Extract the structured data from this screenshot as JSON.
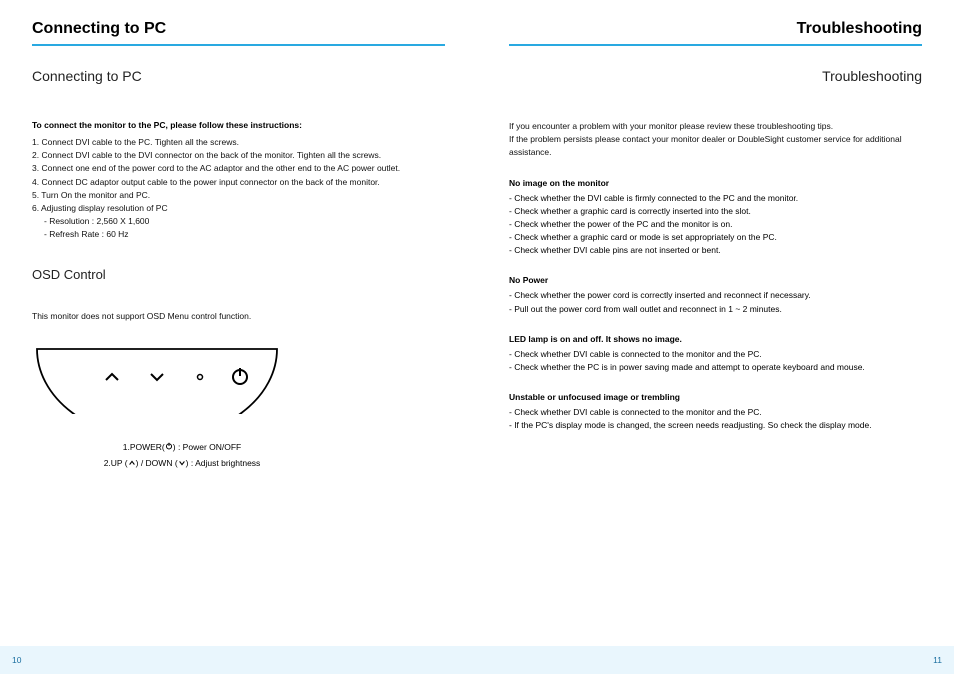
{
  "left": {
    "pageTitle": "Connecting to PC",
    "subhead": "Connecting to PC",
    "intro": "To connect the monitor to the PC, please follow these instructions:",
    "steps": [
      "1. Connect DVI cable to the PC. Tighten all the screws.",
      "2. Connect DVI cable to the DVI connector on the back of the monitor. Tighten all the screws.",
      "3. Connect one end of the power cord to the AC adaptor and the other end to the AC power outlet.",
      "4. Connect DC adaptor output cable to the power input connector on the back of the monitor.",
      "5. Turn On the monitor and PC.",
      "6. Adjusting display resolution of PC"
    ],
    "stepDetails": [
      "- Resolution : 2,560 X 1,600",
      "- Refresh Rate : 60 Hz"
    ],
    "osdHead": "OSD Control",
    "osdNote": "This monitor does not support OSD Menu control function.",
    "legend1_a": "1.POWER(",
    "legend1_b": ") : Power ON/OFF",
    "legend2_a": "2.UP (",
    "legend2_b": ") / DOWN (",
    "legend2_c": ") :  Adjust brightness",
    "pageNum": "10"
  },
  "right": {
    "pageTitle": "Troubleshooting",
    "subhead": "Troubleshooting",
    "intro1": "If you encounter a problem with your monitor please review these troubleshooting tips.",
    "intro2": "If the problem persists please contact your monitor dealer or DoubleSight customer service for additional assistance.",
    "sec1Head": "No image on the monitor",
    "sec1": [
      "- Check whether the DVI cable is firmly connected to the PC and the monitor.",
      "- Check whether a graphic card is correctly inserted into the slot.",
      "- Check whether the power of the PC and the monitor is on.",
      "- Check whether a graphic card or mode is set appropriately on the PC.",
      "- Check whether DVI cable pins are not inserted or bent."
    ],
    "sec2Head": "No Power",
    "sec2": [
      "- Check whether the power cord is correctly inserted and reconnect if necessary.",
      "- Pull out the power cord from wall outlet and reconnect in 1 ~ 2 minutes."
    ],
    "sec3Head": "LED lamp is on and off. It shows no image.",
    "sec3": [
      "- Check whether DVI cable is connected to the monitor and the PC.",
      "- Check whether the PC is in power saving made and attempt to operate keyboard and mouse."
    ],
    "sec4Head": "Unstable or unfocused image or trembling",
    "sec4": [
      "- Check whether DVI cable is connected to the monitor and the PC.",
      "- If the PC's display mode is changed, the screen needs readjusting. So check the display mode."
    ],
    "pageNum": "11"
  }
}
